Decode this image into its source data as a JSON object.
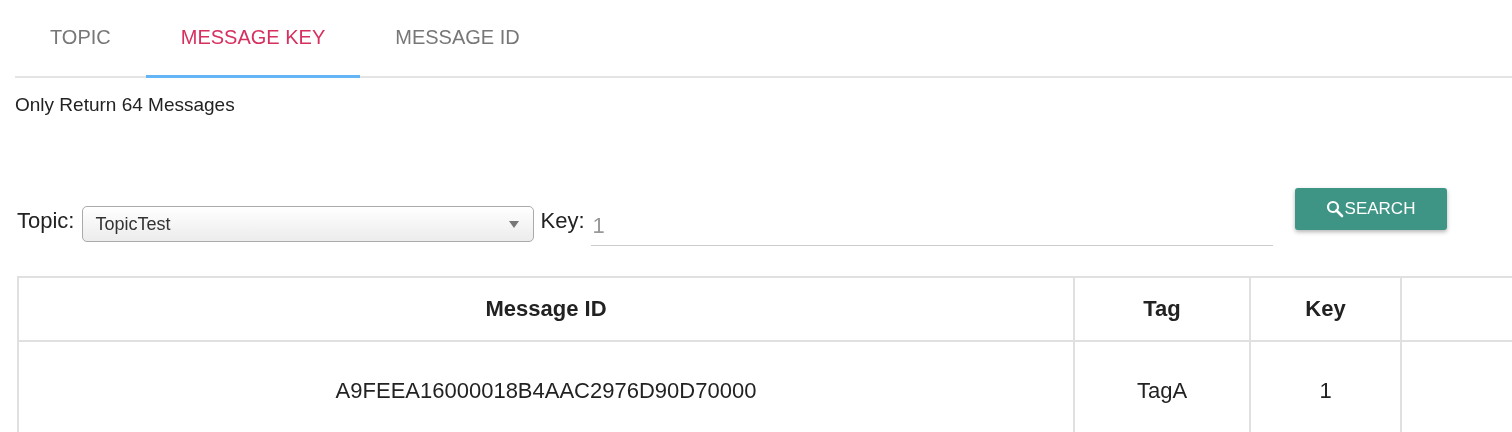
{
  "tabs": [
    {
      "label": "TOPIC",
      "selected": false
    },
    {
      "label": "MESSAGE KEY",
      "selected": true
    },
    {
      "label": "MESSAGE ID",
      "selected": false
    }
  ],
  "notice": "Only Return 64 Messages",
  "form": {
    "topic_label": "Topic:",
    "topic_value": "TopicTest",
    "key_label": "Key:",
    "key_value": "1",
    "search_button": "SEARCH"
  },
  "table": {
    "columns": [
      "Message ID",
      "Tag",
      "Key"
    ],
    "rows": [
      [
        "A9FEEA16000018B4AAC2976D90D70000",
        "TagA",
        "1"
      ]
    ]
  }
}
